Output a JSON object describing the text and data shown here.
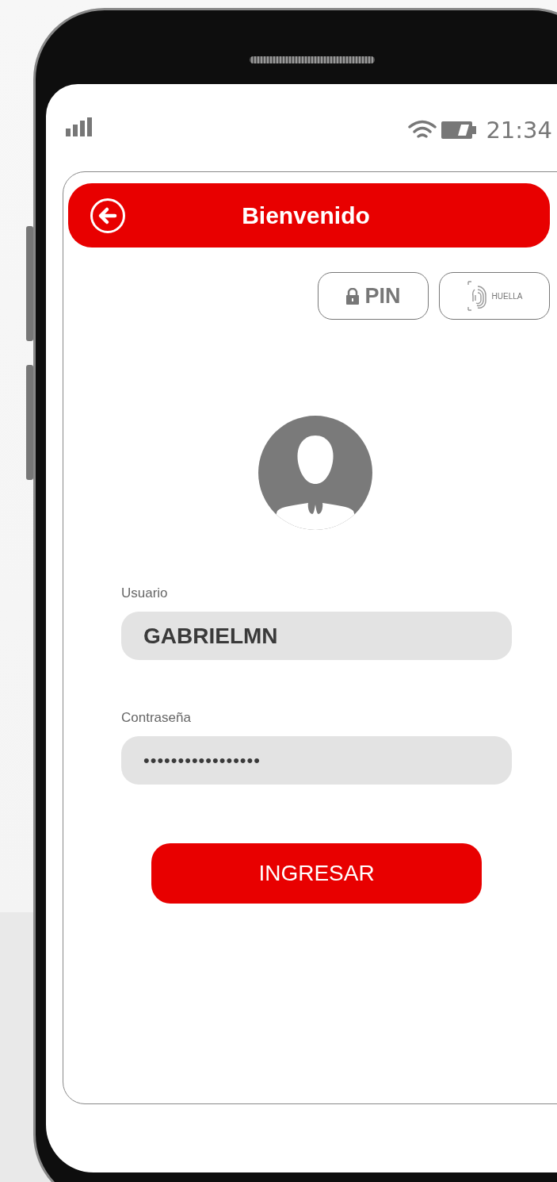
{
  "status_bar": {
    "time": "21:34"
  },
  "header": {
    "title": "Bienvenido"
  },
  "auth_options": [
    {
      "kind": "pin",
      "label": "PIN"
    },
    {
      "kind": "fingerprint",
      "label": "HUELLA"
    }
  ],
  "fields": [
    {
      "label": "Usuario",
      "value": "GABRIELMN",
      "kind": "text"
    },
    {
      "label": "Contraseña",
      "value": "•••••••••••••••••",
      "kind": "password"
    }
  ],
  "submit": {
    "label": "INGRESAR"
  }
}
